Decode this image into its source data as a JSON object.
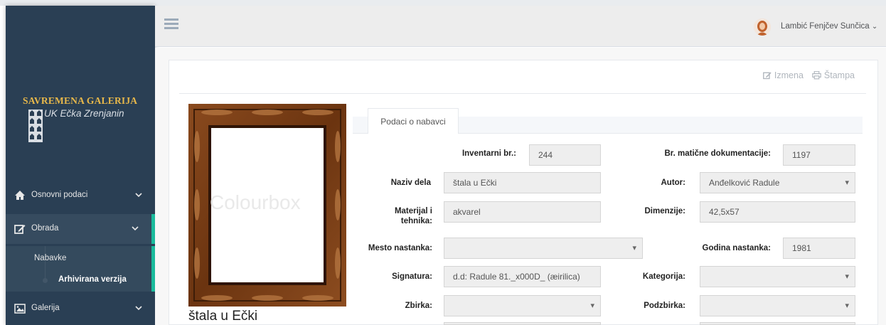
{
  "sidebar": {
    "logo_title": "SAVREMENA GALERIJA",
    "logo_subtitle": "UK Ečka Zrenjanin",
    "items": [
      {
        "label": "Osnovni podaci",
        "icon": "home-icon"
      },
      {
        "label": "Obrada",
        "icon": "edit-icon"
      },
      {
        "label": "Galerija",
        "icon": "picture-icon"
      }
    ],
    "submenu": {
      "label": "Nabavke",
      "child": "Arhivirana verzija"
    }
  },
  "topbar": {
    "user_name": "Lambić Fenjčev Sunčica"
  },
  "actions": {
    "edit_label": "Izmena",
    "print_label": "Štampa"
  },
  "artwork": {
    "title": "štala u Ečki",
    "watermark": "Colourbox"
  },
  "tab_label": "Podaci o nabavci",
  "form": {
    "inv_label": "Inventarni br.:",
    "inv_value": "244",
    "matdoc_label": "Br. matične dokumentacije:",
    "matdoc_value": "1197",
    "naziv_label": "Naziv dela",
    "naziv_value": "štala u Ečki",
    "autor_label": "Autor:",
    "autor_value": "Anđelković Radule",
    "materijal_label": "Materijal i tehnika:",
    "materijal_value": "akvarel",
    "dimenzije_label": "Dimenzije:",
    "dimenzije_value": "42,5x57",
    "mesto_label": "Mesto nastanka:",
    "mesto_value": "",
    "godina_label": "Godina nastanka:",
    "godina_value": "1981",
    "signatura_label": "Signatura:",
    "signatura_value": "d.d: Radule 81._x000D_ (æirilica)",
    "kategorija_label": "Kategorija:",
    "kategorija_value": "",
    "zbirka_label": "Zbirka:",
    "zbirka_value": "",
    "podzbirka_label": "Podzbirka:",
    "podzbirka_value": ""
  },
  "colors": {
    "sidebar_bg": "#2a3f54",
    "accent": "#1abb9c",
    "logo_gold": "#e8b84a"
  }
}
